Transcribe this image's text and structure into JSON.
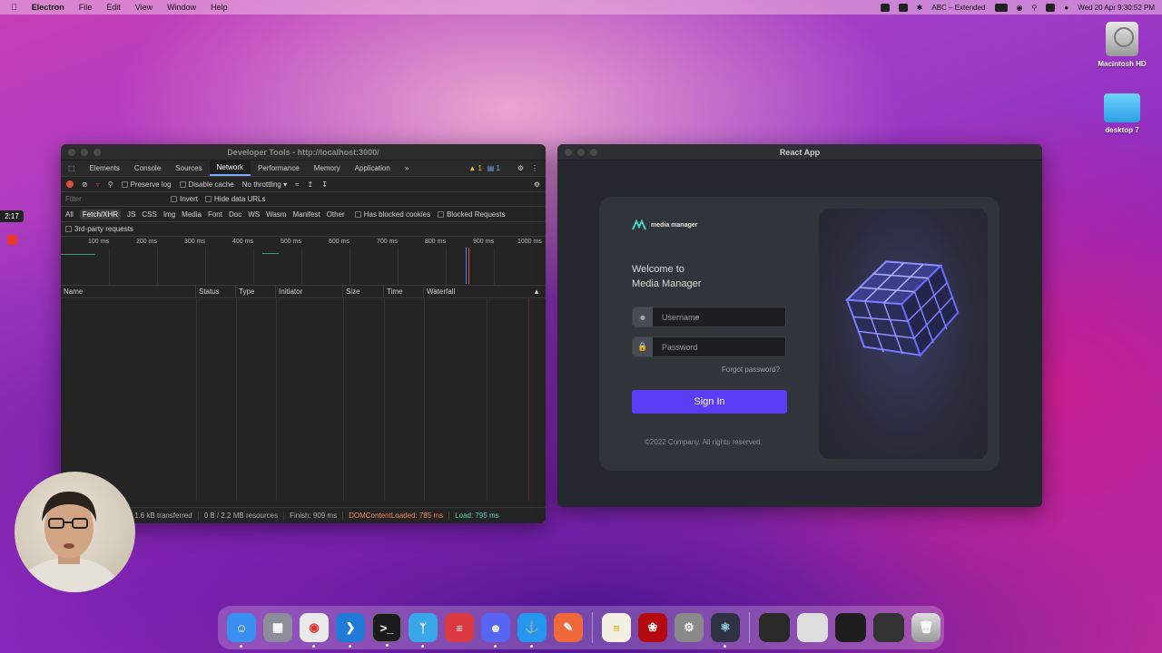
{
  "menubar": {
    "app": "Electron",
    "items": [
      "File",
      "Edit",
      "View",
      "Window",
      "Help"
    ],
    "input_source": "ABC – Extended",
    "datetime": "Wed 20 Apr  9:30:52 PM"
  },
  "desktop": {
    "icons": [
      {
        "label": "Macintosh HD"
      },
      {
        "label": "desktop 7"
      }
    ]
  },
  "recording": {
    "timer": "2:17"
  },
  "devtools": {
    "title": "Developer Tools - http://localhost:3000/",
    "tabs": [
      "Elements",
      "Console",
      "Sources",
      "Network",
      "Performance",
      "Memory",
      "Application",
      "»"
    ],
    "active_tab": "Network",
    "warnings": "1",
    "messages": "1",
    "toolbar": {
      "preserve_log": "Preserve log",
      "disable_cache": "Disable cache",
      "throttling": "No throttling"
    },
    "filter": {
      "placeholder": "Filter",
      "invert": "Invert",
      "hide_data_urls": "Hide data URLs"
    },
    "types": [
      "All",
      "Fetch/XHR",
      "JS",
      "CSS",
      "Img",
      "Media",
      "Font",
      "Doc",
      "WS",
      "Wasm",
      "Manifest",
      "Other"
    ],
    "selected_type": "Fetch/XHR",
    "has_blocked_cookies": "Has blocked cookies",
    "blocked_requests": "Blocked Requests",
    "third_party": "3rd-party requests",
    "timeline_ticks": [
      "100 ms",
      "200 ms",
      "300 ms",
      "400 ms",
      "500 ms",
      "600 ms",
      "700 ms",
      "800 ms",
      "900 ms",
      "1000 ms"
    ],
    "columns": [
      "Name",
      "Status",
      "Type",
      "Initiator",
      "Size",
      "Time",
      "Waterfall"
    ],
    "status": {
      "transferred": "0 / 1.6 kB transferred",
      "resources": "0 B / 2.2 MB resources",
      "finish": "Finish: 909 ms",
      "dcl": "DOMContentLoaded: 785 ms",
      "load": "Load: 795 ms"
    }
  },
  "react_app": {
    "title": "React App",
    "brand": "media manager",
    "welcome_line1": "Welcome to",
    "welcome_line2": "Media Manager",
    "username_placeholder": "Username",
    "password_placeholder": "Password",
    "forgot": "Forgot password?",
    "signin": "Sign In",
    "copyright": "©2022 Company. All rights reserved.",
    "accent": "#5b3df5"
  },
  "dock": {
    "apps": [
      {
        "icon": "finder-icon",
        "color": "#3a8ff0"
      },
      {
        "icon": "launchpad-icon",
        "color": "#8d8d9c"
      },
      {
        "icon": "chrome-icon",
        "color": "#e9e9e9"
      },
      {
        "icon": "vscode-icon",
        "color": "#1f7bd6"
      },
      {
        "icon": "terminal-icon",
        "color": "#1b1b1b"
      },
      {
        "icon": "fork-icon",
        "color": "#3aa7e8"
      },
      {
        "icon": "expressvpn-icon",
        "color": "#da3940"
      },
      {
        "icon": "discord-icon",
        "color": "#5865f2"
      },
      {
        "icon": "docker-icon",
        "color": "#2496ed"
      },
      {
        "icon": "paw-icon",
        "color": "#f0673a"
      },
      {
        "icon": "notes-icon",
        "color": "#f4f1e4"
      },
      {
        "icon": "acrobat-icon",
        "color": "#b3090f"
      },
      {
        "icon": "system-preferences-icon",
        "color": "#8a8a8a"
      },
      {
        "icon": "electron-icon",
        "color": "#2f3242"
      }
    ]
  }
}
